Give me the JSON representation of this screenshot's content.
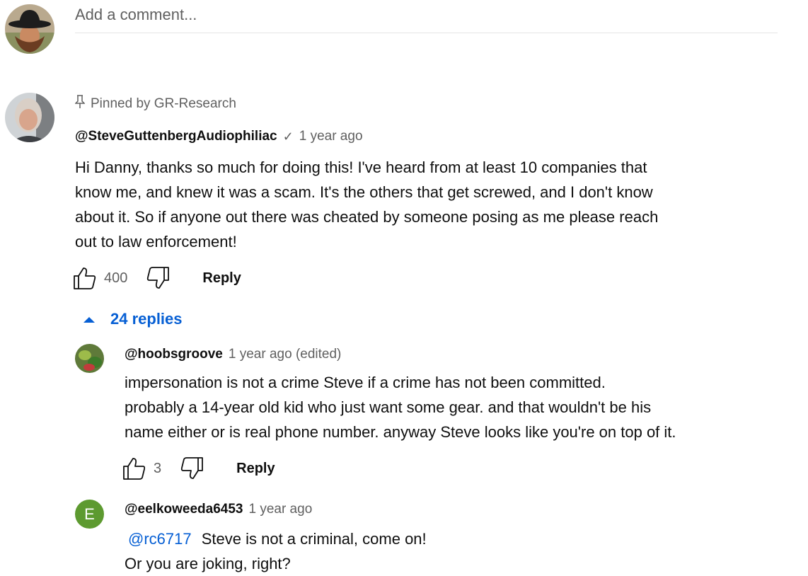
{
  "add_comment": {
    "placeholder": "Add a comment..."
  },
  "pinned_comment": {
    "pinned_label": "Pinned by GR-Research",
    "author": "@SteveGuttenbergAudiophiliac",
    "verified": "✓",
    "time": "1 year ago",
    "lines": [
      "Hi Danny, thanks so much for doing this! I've heard from at least 10 companies that",
      "know me, and knew it was a scam. It's the others that get screwed, and I don't know",
      "about it. So if anyone out there was cheated by someone posing as me please reach",
      "out to law enforcement!"
    ],
    "likes": "400",
    "reply_label": "Reply"
  },
  "replies_toggle": {
    "label": "24 replies"
  },
  "replies": [
    {
      "author": "@hoobsgroove",
      "time": "1 year ago (edited)",
      "lines": [
        "impersonation is not a crime Steve if a crime has not been committed.",
        "probably a 14-year old kid who just want some gear. and that wouldn't be his",
        "name either or is real phone number. anyway Steve looks like you're on top of it."
      ],
      "likes": "3",
      "reply_label": "Reply"
    },
    {
      "author": "@eelkoweeda6453",
      "avatar_letter": "E",
      "time": "1 year ago",
      "mention": "@rc6717",
      "line1_rest": "Steve is not a criminal, come on!",
      "line2": "Or you are joking, right?"
    }
  ],
  "colors": {
    "link_blue": "#065fd4",
    "meta_gray": "#606060",
    "avatar_green": "#5d9a30"
  }
}
